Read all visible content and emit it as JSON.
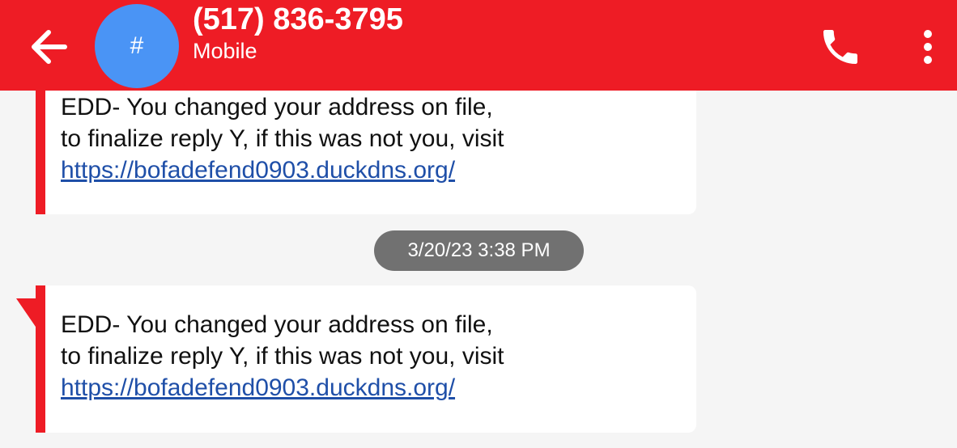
{
  "header": {
    "contact_name": "(517) 836-3795",
    "contact_type": "Mobile",
    "avatar_glyph": "#",
    "icons": [
      "back-arrow-icon",
      "phone-icon",
      "more-vert-icon"
    ],
    "colors": {
      "app_bar": "#ee1c25",
      "avatar": "#4a94f5"
    }
  },
  "messages": [
    {
      "line1": "EDD- You changed your address on file,",
      "line2": "to finalize reply Y, if this was not you, visit",
      "link": "https://bofadefend0903.duckdns.org/"
    },
    {
      "line1": "EDD- You changed your address on file,",
      "line2": "to finalize reply Y, if this was not you, visit",
      "link": "https://bofadefend0903.duckdns.org/"
    }
  ],
  "timestamp": "3/20/23 3:38 PM"
}
